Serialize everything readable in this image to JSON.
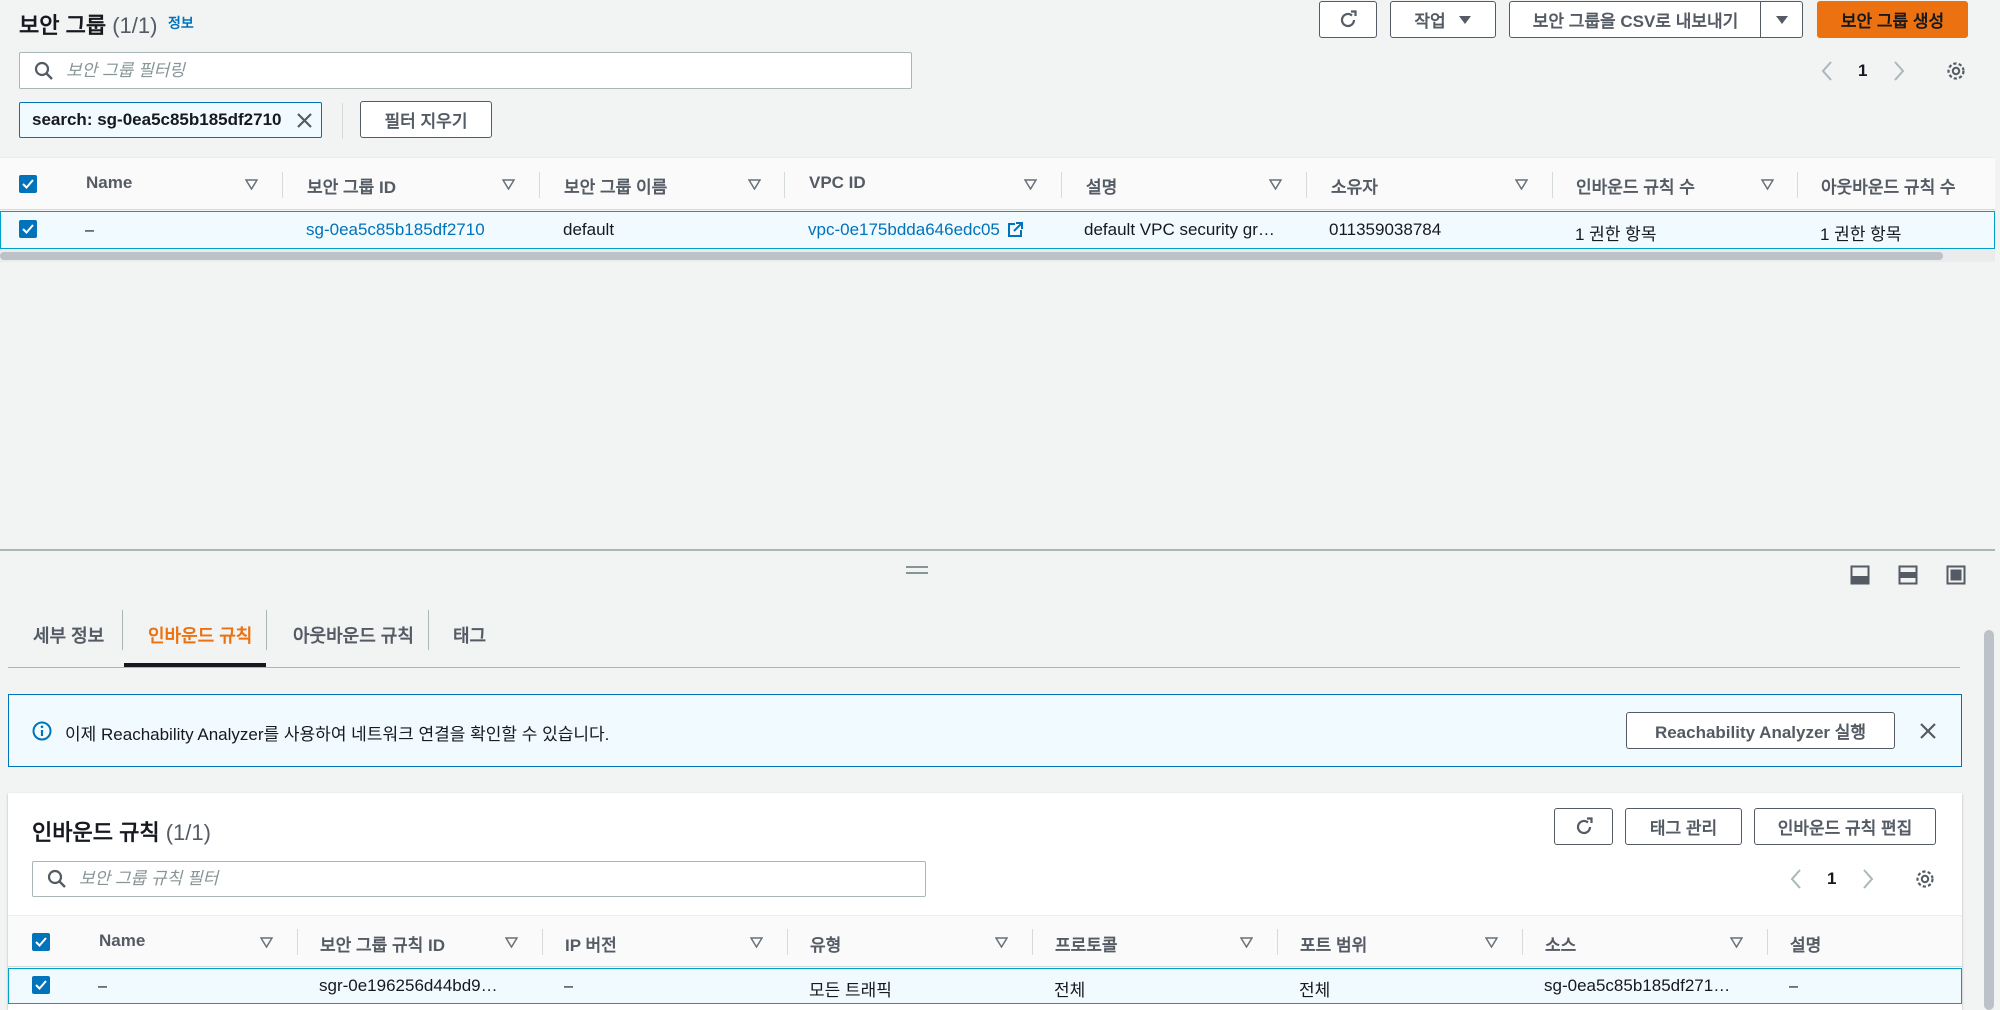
{
  "top": {
    "title": "보안 그룹",
    "count": "(1/1)",
    "info_link": "정보",
    "refresh_icon": "refresh-icon",
    "actions_label": "작업",
    "export_label": "보안 그룹을 CSV로 내보내기",
    "create_label": "보안 그룹 생성",
    "search_placeholder": "보안 그룹 필터링",
    "filter_token": "search: sg-0ea5c85b185df2710",
    "clear_filters": "필터 지우기",
    "page": "1",
    "columns": [
      "Name",
      "보안 그룹 ID",
      "보안 그룹 이름",
      "VPC ID",
      "설명",
      "소유자",
      "인바운드 규칙 수",
      "아웃바운드 규칙 수"
    ],
    "row": {
      "name": "–",
      "sg_id": "sg-0ea5c85b185df2710",
      "sg_name": "default",
      "vpc_id": "vpc-0e175bdda646edc05",
      "description": "default VPC security gr…",
      "owner": "011359038784",
      "inbound": "1 권한 항목",
      "outbound": "1 권한 항목"
    }
  },
  "details": {
    "tabs": [
      "세부 정보",
      "인바운드 규칙",
      "아웃바운드 규칙",
      "태그"
    ],
    "active_tab": 1,
    "banner_text": "이제 Reachability Analyzer를 사용하여 네트워크 연결을 확인할 수 있습니다.",
    "banner_button": "Reachability Analyzer 실행",
    "inbound_title": "인바운드 규칙",
    "inbound_count": "(1/1)",
    "manage_tags": "태그 관리",
    "edit_inbound": "인바운드 규칙 편집",
    "rule_search_placeholder": "보안 그룹 규칙 필터",
    "page": "1",
    "columns": [
      "Name",
      "보안 그룹 규칙 ID",
      "IP 버전",
      "유형",
      "프로토콜",
      "포트 범위",
      "소스",
      "설명"
    ],
    "row": {
      "name": "–",
      "rule_id": "sgr-0e196256d44bd9…",
      "ip_version": "–",
      "type": "모든 트래픽",
      "protocol": "전체",
      "port_range": "전체",
      "source": "sg-0ea5c85b185df271…",
      "description": "–"
    }
  },
  "colors": {
    "accent": "#ec7211",
    "link": "#0073bb",
    "selected_row": "#f1faff"
  }
}
